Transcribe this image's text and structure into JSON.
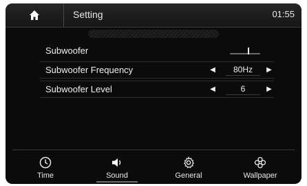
{
  "header": {
    "title": "Setting",
    "time": "01:55",
    "home_icon": "home-icon"
  },
  "settings": [
    {
      "label": "Subwoofer",
      "control": "toggle",
      "state": "on"
    },
    {
      "label": "Subwoofer Frequency",
      "control": "stepper",
      "value": "80Hz"
    },
    {
      "label": "Subwoofer  Level",
      "control": "stepper",
      "value": "6"
    }
  ],
  "tabs": [
    {
      "label": "Time",
      "icon": "clock-icon"
    },
    {
      "label": "Sound",
      "icon": "speaker-icon",
      "active": true
    },
    {
      "label": "General",
      "icon": "gear-icon"
    },
    {
      "label": "Wallpaper",
      "icon": "flower-icon"
    }
  ],
  "colors": {
    "background": "#0b0b0b",
    "text": "#f0f0f0"
  }
}
